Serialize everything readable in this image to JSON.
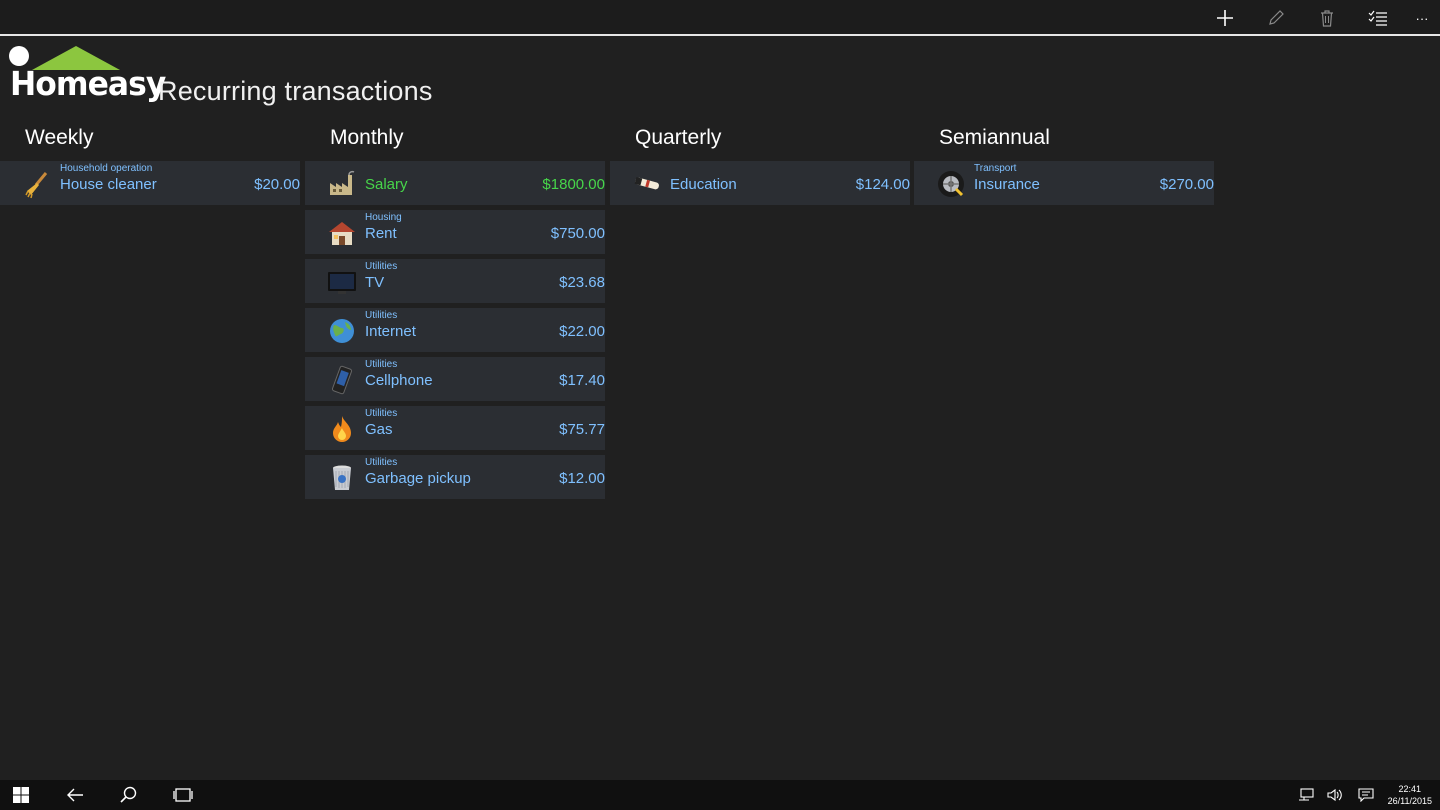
{
  "toolbar": {
    "icons": [
      "add-icon",
      "edit-icon",
      "delete-icon",
      "select-list-icon",
      "more-icon"
    ],
    "more_label": "···"
  },
  "app": {
    "logo_text": "Homeasy",
    "title": "Recurring transactions"
  },
  "columns": [
    {
      "title": "Weekly",
      "items": [
        {
          "category": "Household operation",
          "name": "House cleaner",
          "amount": "$20.00",
          "icon": "broom-icon"
        }
      ]
    },
    {
      "title": "Monthly",
      "items": [
        {
          "category": "",
          "name": "Salary",
          "amount": "$1800.00",
          "icon": "factory-icon",
          "type": "income"
        },
        {
          "category": "Housing",
          "name": "Rent",
          "amount": "$750.00",
          "icon": "house-icon"
        },
        {
          "category": "Utilities",
          "name": "TV",
          "amount": "$23.68",
          "icon": "tv-icon"
        },
        {
          "category": "Utilities",
          "name": "Internet",
          "amount": "$22.00",
          "icon": "globe-icon"
        },
        {
          "category": "Utilities",
          "name": "Cellphone",
          "amount": "$17.40",
          "icon": "cellphone-icon"
        },
        {
          "category": "Utilities",
          "name": "Gas",
          "amount": "$75.77",
          "icon": "flame-icon"
        },
        {
          "category": "Utilities",
          "name": "Garbage pickup",
          "amount": "$12.00",
          "icon": "recycle-bin-icon"
        }
      ]
    },
    {
      "title": "Quarterly",
      "items": [
        {
          "category": "",
          "name": "Education",
          "amount": "$124.00",
          "icon": "diploma-icon"
        }
      ]
    },
    {
      "title": "Semiannual",
      "items": [
        {
          "category": "Transport",
          "name": "Insurance",
          "amount": "$270.00",
          "icon": "tire-icon"
        }
      ]
    }
  ],
  "colors": {
    "expense": "#7fc0ff",
    "income": "#47d64a",
    "background": "#202020",
    "tile": "#2b2e33",
    "logo_roof": "#8cc63f"
  },
  "taskbar": {
    "icons": [
      "windows-start-icon",
      "back-arrow-icon",
      "search-icon",
      "task-view-icon"
    ],
    "tray_icons": [
      "network-icon",
      "volume-icon",
      "action-center-icon"
    ],
    "time": "22:41",
    "date": "26/11/2015"
  }
}
